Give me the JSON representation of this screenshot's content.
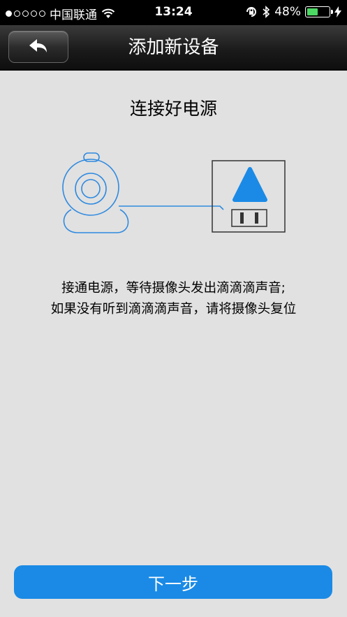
{
  "status_bar": {
    "carrier": "中国联通",
    "time": "13:24",
    "battery": "48%",
    "battery_level": 0.48,
    "signal_bars_filled": 1,
    "signal_bars_total": 5
  },
  "nav": {
    "title": "添加新设备",
    "back_icon": "back-arrow-icon"
  },
  "main": {
    "heading": "连接好电源",
    "instruction_line1": "接通电源，等待摄像头发出滴滴滴声音;",
    "instruction_line2": "如果没有听到滴滴滴声音，请将摄像头复位"
  },
  "footer": {
    "next_label": "下一步"
  },
  "colors": {
    "accent": "#1a8ae6",
    "illustration_blue": "#2f8ae0",
    "battery_green": "#4cd964"
  }
}
